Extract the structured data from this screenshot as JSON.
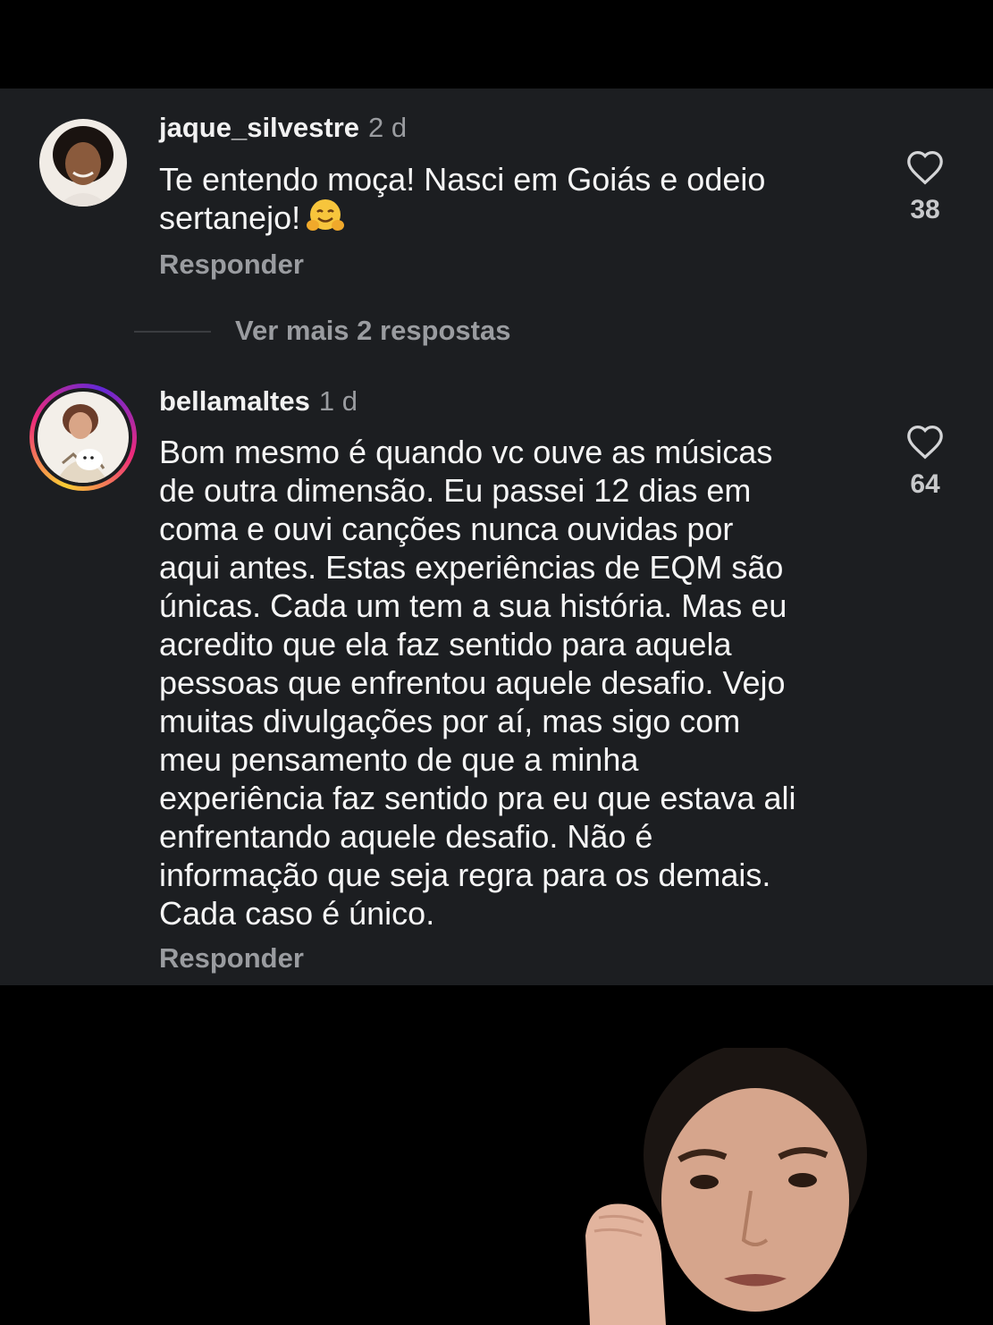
{
  "comments": [
    {
      "username": "jaque_silvestre",
      "time": "2 d",
      "text": "Te entendo moça! Nasci em Goiás e odeio\nsertanejo!",
      "emoji": "hugging-face-emoji",
      "likes": "38",
      "reply_label": "Responder"
    },
    {
      "username": "bellamaltes",
      "time": "1 d",
      "text": "Bom mesmo é quando vc ouve as músicas\nde outra dimensão. Eu passei 12 dias em\ncoma e ouvi canções nunca ouvidas por\naqui antes. Estas experiências de EQM são\núnicas. Cada um tem a sua história. Mas eu\nacredito que ela faz sentido para aquela\npessoas que enfrentou aquele desafio. Vejo\nmuitas divulgações por aí, mas sigo com\nmeu pensamento de que a minha\nexperiência faz sentido pra eu que estava ali\nenfrentando aquele desafio. Não é\ninformação que seja regra para os demais.\nCada caso é único.",
      "likes": "64",
      "reply_label": "Responder"
    }
  ],
  "view_more_replies": "Ver mais 2 respostas",
  "colors": {
    "panel_background": "#1c1e21",
    "page_background": "#000000",
    "primary_text": "#f5f5f5",
    "secondary_text": "#9a9ca0",
    "story_ring": [
      "#f9ce34",
      "#ee2a7b",
      "#6228d7"
    ]
  }
}
